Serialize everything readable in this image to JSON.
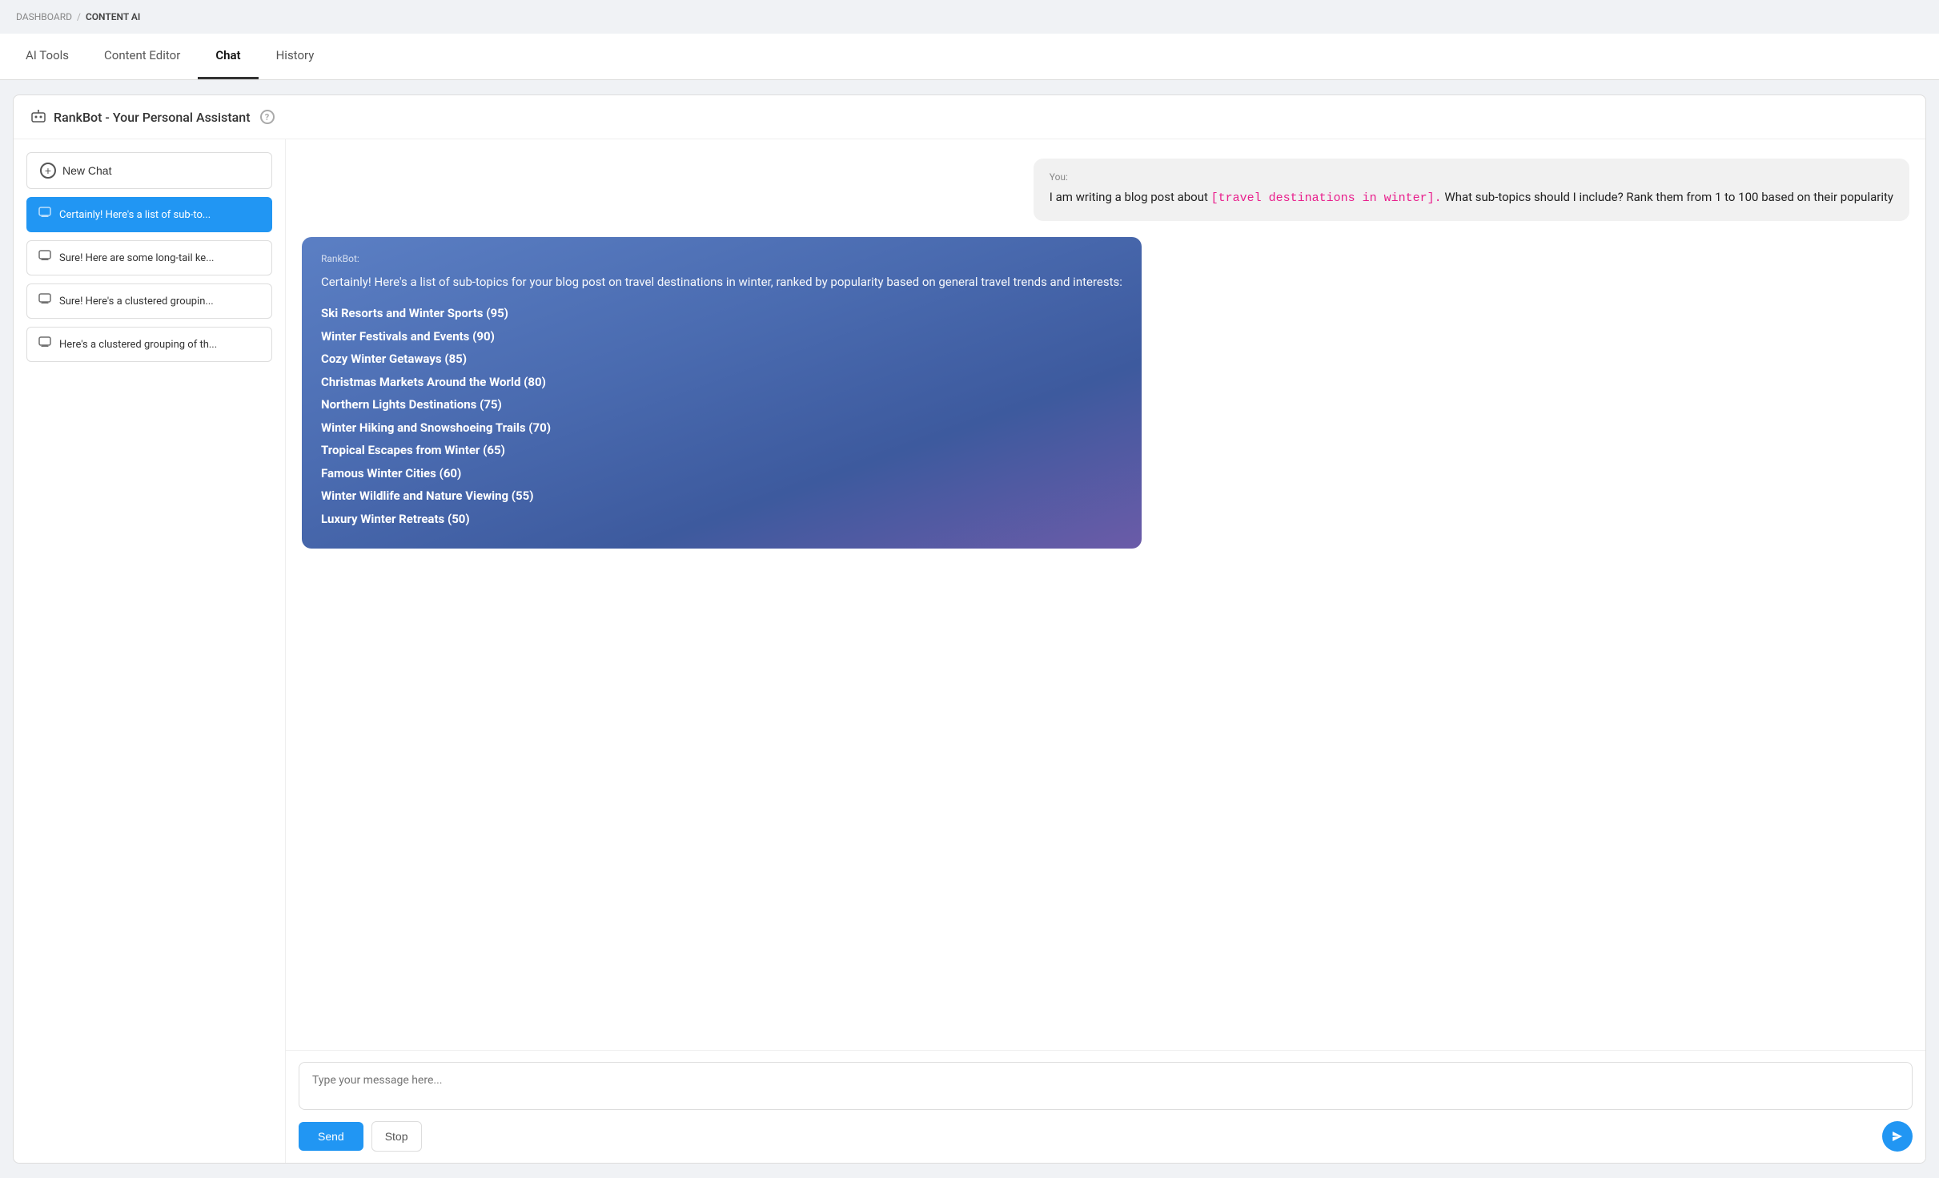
{
  "breadcrumb": {
    "parent": "DASHBOARD",
    "separator": "/",
    "current": "CONTENT AI"
  },
  "tabs": [
    {
      "id": "ai-tools",
      "label": "AI Tools",
      "active": false
    },
    {
      "id": "content-editor",
      "label": "Content Editor",
      "active": false
    },
    {
      "id": "chat",
      "label": "Chat",
      "active": true
    },
    {
      "id": "history",
      "label": "History",
      "active": false
    }
  ],
  "rankbot": {
    "title": "RankBot - Your Personal Assistant",
    "help_label": "?"
  },
  "sidebar": {
    "new_chat_label": "New Chat",
    "history_items": [
      {
        "id": "item-1",
        "label": "Certainly! Here's a list of sub-to...",
        "active": true
      },
      {
        "id": "item-2",
        "label": "Sure! Here are some long-tail ke...",
        "active": false
      },
      {
        "id": "item-3",
        "label": "Sure! Here's a clustered groupin...",
        "active": false
      },
      {
        "id": "item-4",
        "label": "Here's a clustered grouping of th...",
        "active": false
      }
    ]
  },
  "chat": {
    "user_label": "You:",
    "user_message_prefix": "I am writing a blog post about ",
    "user_message_highlight": "[travel destinations in winter].",
    "user_message_suffix": " What sub-topics should I include? Rank them from 1 to 100 based on their popularity",
    "bot_label": "RankBot:",
    "bot_intro": "Certainly! Here's a list of sub-topics for your blog post on travel destinations in winter, ranked by popularity based on general travel trends and interests:",
    "bot_list": [
      "Ski Resorts and Winter Sports (95)",
      "Winter Festivals and Events (90)",
      "Cozy Winter Getaways (85)",
      "Christmas Markets Around the World (80)",
      "Northern Lights Destinations (75)",
      "Winter Hiking and Snowshoeing Trails (70)",
      "Tropical Escapes from Winter (65)",
      "Famous Winter Cities (60)",
      "Winter Wildlife and Nature Viewing (55)",
      "Luxury Winter Retreats (50)"
    ]
  },
  "input": {
    "placeholder": "Type your message here...",
    "send_label": "Send",
    "stop_label": "Stop"
  }
}
